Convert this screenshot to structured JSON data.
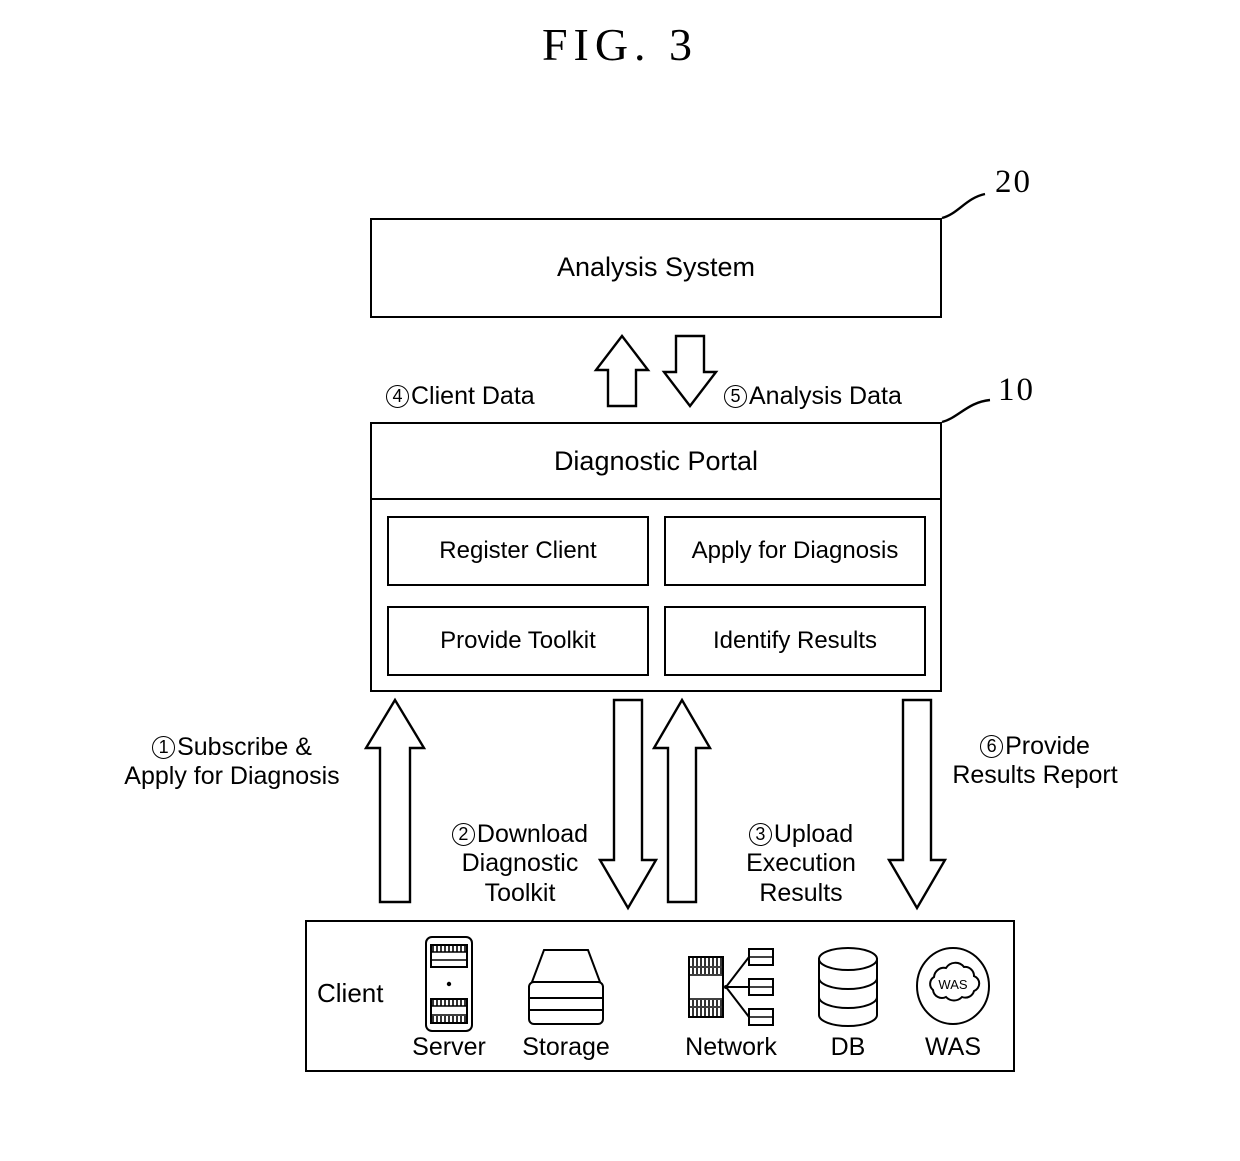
{
  "figure": {
    "title": "FIG. 3"
  },
  "reference_numerals": {
    "analysis_system": "20",
    "diagnostic_portal": "10"
  },
  "analysis_system": {
    "label": "Analysis System"
  },
  "diagnostic_portal": {
    "header": "Diagnostic Portal",
    "cells": [
      {
        "id": "register-client",
        "label": "Register Client"
      },
      {
        "id": "apply-for-diagnosis",
        "label": "Apply for\nDiagnosis"
      },
      {
        "id": "provide-toolkit",
        "label": "Provide Toolkit"
      },
      {
        "id": "identify-results",
        "label": "Identify Results"
      }
    ]
  },
  "flows": [
    {
      "number": "1",
      "marker": "①",
      "label": "Subscribe &\nApply for Diagnosis",
      "direction": "up",
      "from": "client",
      "to": "diagnostic-portal"
    },
    {
      "number": "2",
      "marker": "②",
      "label": "Download\nDiagnostic\nToolkit",
      "direction": "down",
      "from": "diagnostic-portal",
      "to": "client"
    },
    {
      "number": "3",
      "marker": "③",
      "label": "Upload\nExecution\nResults",
      "direction": "up",
      "from": "client",
      "to": "diagnostic-portal"
    },
    {
      "number": "4",
      "marker": "④",
      "label": "Client Data",
      "direction": "up",
      "from": "diagnostic-portal",
      "to": "analysis-system"
    },
    {
      "number": "5",
      "marker": "⑤",
      "label": "Analysis Data",
      "direction": "down",
      "from": "analysis-system",
      "to": "diagnostic-portal"
    },
    {
      "number": "6",
      "marker": "⑥",
      "label": "Provide\nResults Report",
      "direction": "down",
      "from": "diagnostic-portal",
      "to": "client"
    }
  ],
  "client_box": {
    "label": "Client",
    "items": [
      {
        "icon": "server-icon",
        "label": "Server"
      },
      {
        "icon": "storage-icon",
        "label": "Storage"
      },
      {
        "icon": "network-icon",
        "label": "Network"
      },
      {
        "icon": "database-icon",
        "label": "DB"
      },
      {
        "icon": "was-cloud-icon",
        "label": "WAS",
        "icon_text": "WAS"
      }
    ]
  },
  "colors": {
    "stroke": "#000000",
    "background": "#ffffff"
  }
}
